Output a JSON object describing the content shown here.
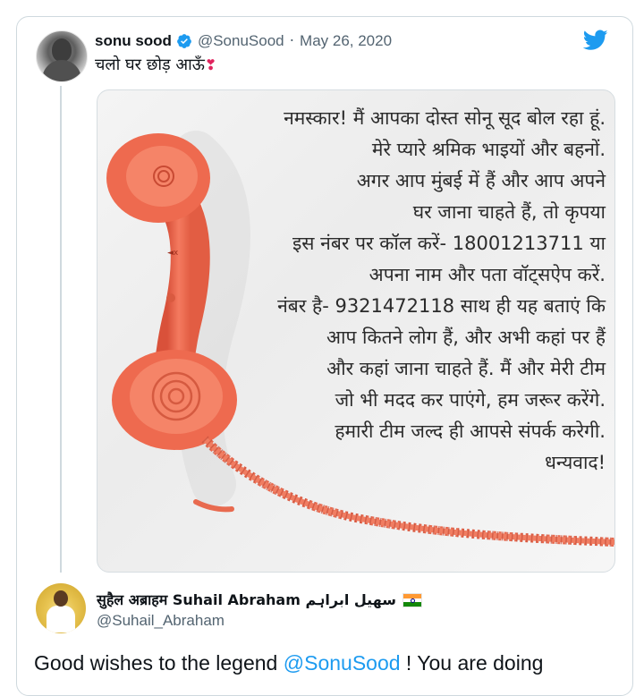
{
  "tweet": {
    "author_name": "sonu sood",
    "author_handle": "@SonuSood",
    "separator": "·",
    "date": "May 26, 2020",
    "text": "चलो घर छोड़ आऊँ",
    "emoji": "❣",
    "verified": true,
    "brand_icon": "twitter-bird-icon",
    "brand_color": "#1d9bf0",
    "media": {
      "phone_color": "#f06a4f",
      "lines": [
        "नमस्कार! मैं आपका दोस्त सोनू सूद बोल रहा हूं.",
        "मेरे प्यारे श्रमिक भाइयों और बहनों.",
        "अगर आप मुंबई में हैं और आप अपने",
        "घर जाना चाहते हैं, तो कृपया",
        "इस नंबर पर कॉल करें- 18001213711 या",
        "अपना नाम और पता वॉट्सऐप करें.",
        "नंबर है- 9321472118 साथ ही यह बताएं कि",
        "आप कितने लोग हैं, और अभी कहां पर हैं",
        "और कहां जाना चाहते हैं. मैं और मेरी टीम",
        "जो भी मदद कर पाएंगे, हम जरूर करेंगे.",
        "हमारी टीम जल्द ही आपसे संपर्क करेगी.",
        "धन्यवाद!"
      ]
    }
  },
  "reply": {
    "author_name": "सुहैल अब्राहम Suhail Abraham سهیل ابراہم",
    "flag": "india-flag-icon",
    "author_handle": "@Suhail_Abraham",
    "text_before": "Good wishes to the legend ",
    "mention": "@SonuSood",
    "text_after": " ! You are doing"
  }
}
